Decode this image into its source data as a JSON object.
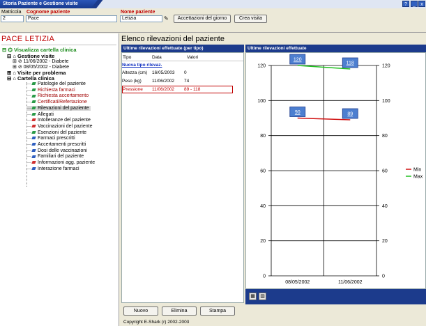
{
  "window": {
    "title": "Storia Paziente e Gestione visite",
    "controls": [
      "?",
      "_",
      "x"
    ]
  },
  "form": {
    "matricola_label": "Matricola",
    "matricola_value": "2",
    "cognome_label": "Cognome paziente",
    "cognome_value": "Pace",
    "nome_label": "Nome paziente",
    "nome_value": "Letizia",
    "accettazioni_button": "Accettazioni del giorno",
    "crea_visita_button": "Crea visita"
  },
  "patient_name": "PACE LETIZIA",
  "tree": {
    "root": "Visualizza cartella clinica",
    "gestione_visite": "Gestione visite",
    "visite": [
      "11/06/2002 - Diabete",
      "08/05/2002 - Diabete"
    ],
    "visite_per_problema": "Visite per problema",
    "cartella_clinica": "Cartella clinica",
    "items": [
      {
        "label": "Patologie del paziente",
        "color": "#000000",
        "bullet": "#2a9a48"
      },
      {
        "label": "Richiesta farmaci",
        "color": "#a00000",
        "bullet": "#2a9a48"
      },
      {
        "label": "Richiesta accertamento",
        "color": "#a00000",
        "bullet": "#2a9a48"
      },
      {
        "label": "Certificati/Refertazione",
        "color": "#a00000",
        "bullet": "#2a9a48"
      },
      {
        "label": "Rilevazioni del paziente",
        "color": "#000000",
        "bullet": "#2a9a48"
      },
      {
        "label": "Allegati",
        "color": "#000000",
        "bullet": "#2a9a48"
      },
      {
        "label": "Intolleranze del paziente",
        "color": "#000000",
        "bullet": "#d03030"
      },
      {
        "label": "Vaccinazioni del paziente",
        "color": "#000000",
        "bullet": "#d03030"
      },
      {
        "label": "Esenzioni del paziente",
        "color": "#000000",
        "bullet": "#2a9a48"
      },
      {
        "label": "Farmaci prescritti",
        "color": "#000000",
        "bullet": "#2f5fc0"
      },
      {
        "label": "Accertamenti prescritti",
        "color": "#000000",
        "bullet": "#2f5fc0"
      },
      {
        "label": "Dosi delle vaccinazioni",
        "color": "#000000",
        "bullet": "#2f5fc0"
      },
      {
        "label": "Familiari del paziente",
        "color": "#000000",
        "bullet": "#2f5fc0"
      },
      {
        "label": "Informazioni agg. paziente",
        "color": "#000000",
        "bullet": "#d03030"
      },
      {
        "label": "Interazione farmaci",
        "color": "#000000",
        "bullet": "#2f5fc0"
      }
    ]
  },
  "main": {
    "title": "Elenco rilevazioni del paziente",
    "list_header": "Ultime rilevazioni effettuate (per tipo)",
    "columns": [
      "Tipo",
      "Data",
      "Valori"
    ],
    "new_link": "Nuova tipo rilevaz.",
    "rows": [
      {
        "tipo": "Altezza (cm)",
        "data": "16/05/2003",
        "valori": "0",
        "color": "#000000"
      },
      {
        "tipo": "Peso (kg)",
        "data": "11/06/2002",
        "valori": "74",
        "color": "#000000"
      },
      {
        "tipo": "Pressione",
        "data": "11/06/2002",
        "valori": "89 - 118",
        "color": "#c00000"
      }
    ],
    "buttons": {
      "nuovo": "Nuovo",
      "elimina": "Elimina",
      "stampa": "Stampa"
    },
    "copyright": "Copyright E-Shark (r) 2002-2003"
  },
  "chart_header": "Ultime rilevazioni effettuate",
  "chart_data": {
    "type": "line",
    "categories": [
      "08/05/2002",
      "11/06/2002"
    ],
    "series": [
      {
        "name": "Min",
        "values": [
          90,
          89
        ],
        "color": "#d01010"
      },
      {
        "name": "Max",
        "values": [
          120,
          118
        ],
        "color": "#20c020"
      }
    ],
    "ylim": [
      0,
      120
    ],
    "yticks": [
      "0",
      "20",
      "40",
      "60",
      "80",
      "100",
      "120"
    ],
    "grid": true,
    "legend": "right"
  }
}
